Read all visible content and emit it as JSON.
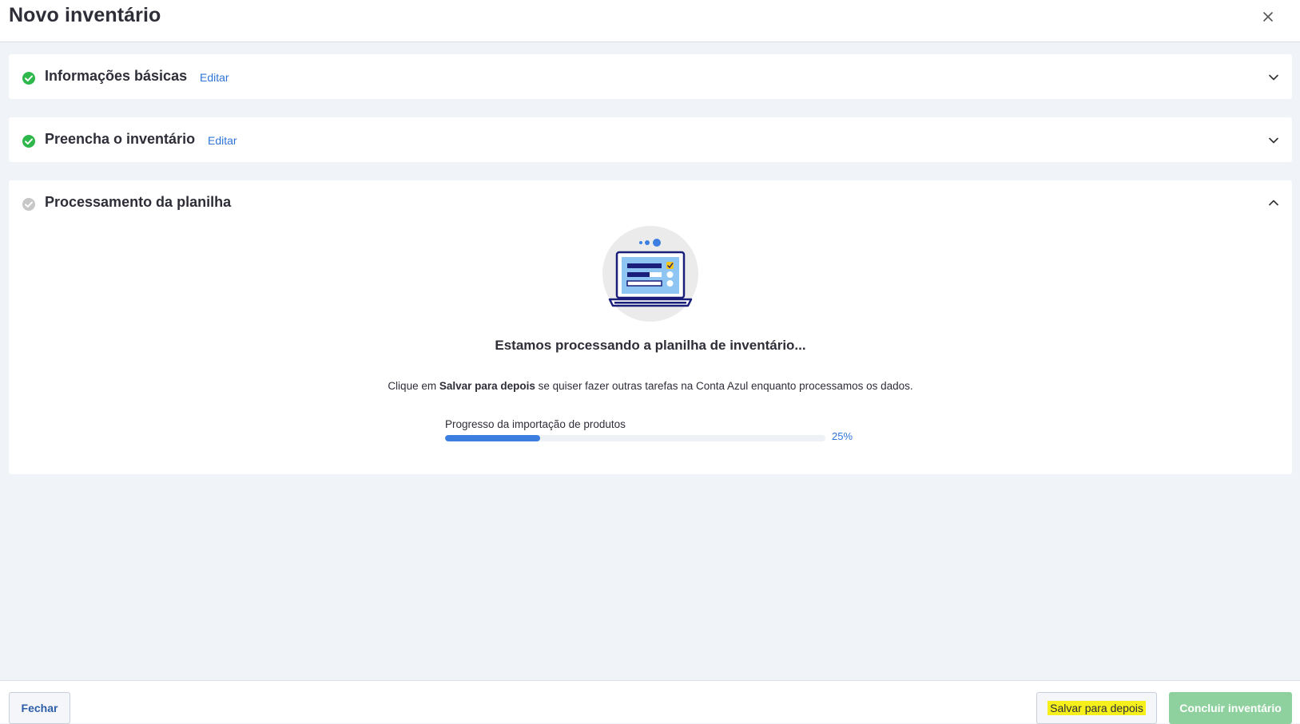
{
  "header": {
    "title": "Novo inventário",
    "close_icon": "close-icon"
  },
  "sections": [
    {
      "title": "Informações básicas",
      "edit_label": "Editar",
      "status": "complete",
      "status_color": "#2eb84b",
      "expanded": false
    },
    {
      "title": "Preencha o inventário",
      "edit_label": "Editar",
      "status": "complete",
      "status_color": "#2eb84b",
      "expanded": false
    },
    {
      "title": "Processamento da planilha",
      "status": "pending",
      "status_color": "#c7c7c7",
      "expanded": true
    }
  ],
  "processing": {
    "illustration": "laptop-processing-illustration",
    "title": "Estamos processando a planilha de inventário...",
    "desc_prefix": "Clique em ",
    "desc_bold": "Salvar para depois",
    "desc_suffix": " se quiser fazer outras tarefas na Conta Azul enquanto processamos os dados.",
    "progress_label": "Progresso da importação de produtos",
    "progress_percent": 25,
    "progress_text": "25%",
    "progress_color": "#3d7fe0"
  },
  "footer": {
    "close_label": "Fechar",
    "save_label": "Salvar para depois",
    "finish_label": "Concluir inventário",
    "finish_color": "#8fd19e",
    "highlight_color": "#f5f01c"
  }
}
